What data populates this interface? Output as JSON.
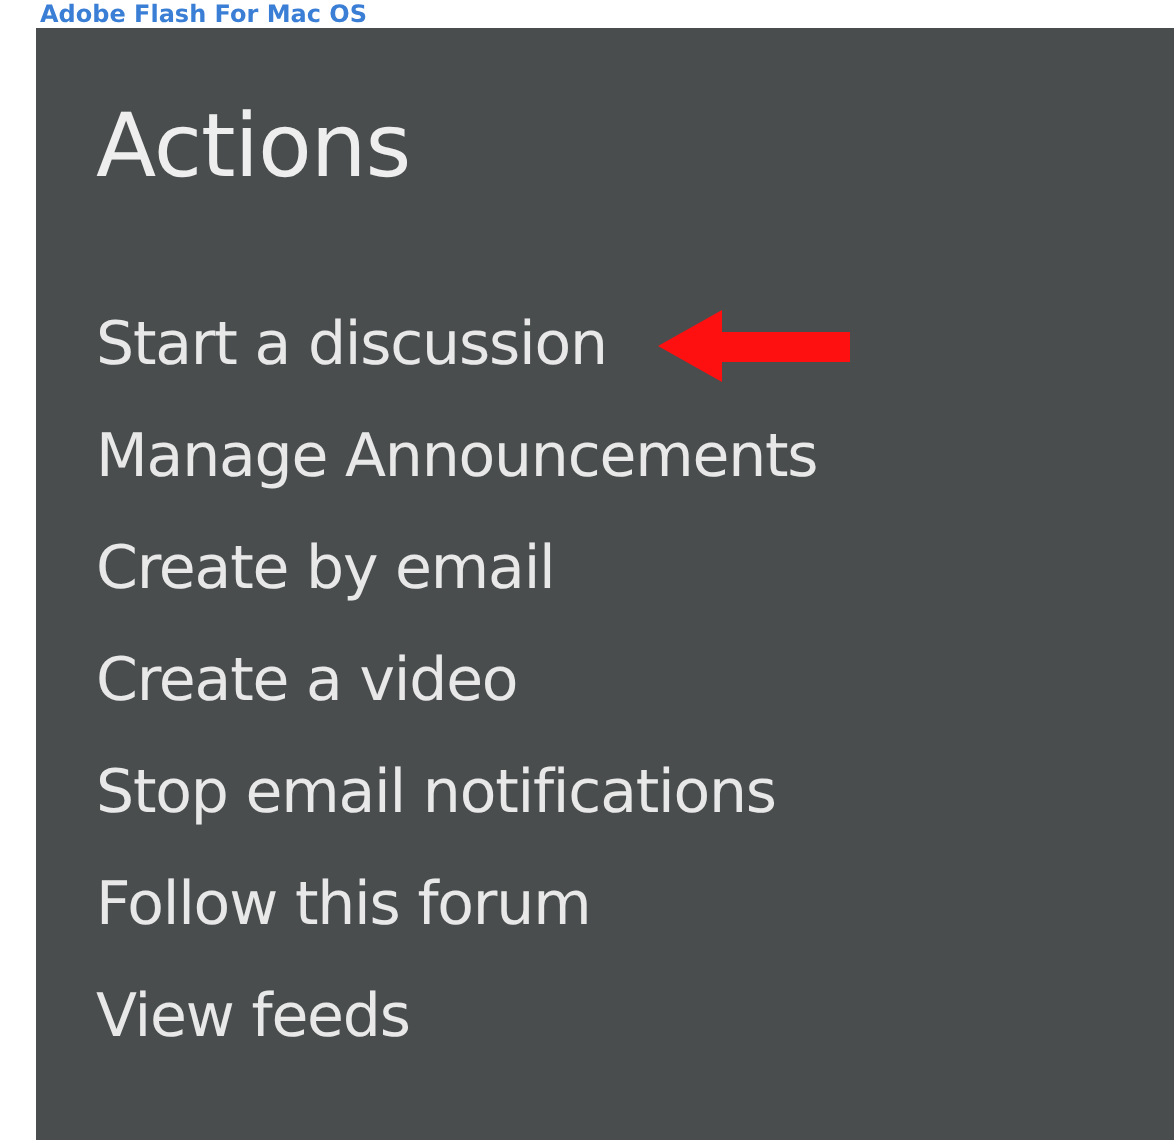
{
  "header_link": "Adobe Flash For Mac OS",
  "panel": {
    "title": "Actions",
    "items": [
      {
        "label": "Start a discussion",
        "pointed": true
      },
      {
        "label": "Manage Announcements",
        "pointed": false
      },
      {
        "label": "Create by email",
        "pointed": false
      },
      {
        "label": "Create a video",
        "pointed": false
      },
      {
        "label": "Stop email notifications",
        "pointed": false
      },
      {
        "label": "Follow this forum",
        "pointed": false
      },
      {
        "label": "View feeds",
        "pointed": false
      }
    ]
  }
}
